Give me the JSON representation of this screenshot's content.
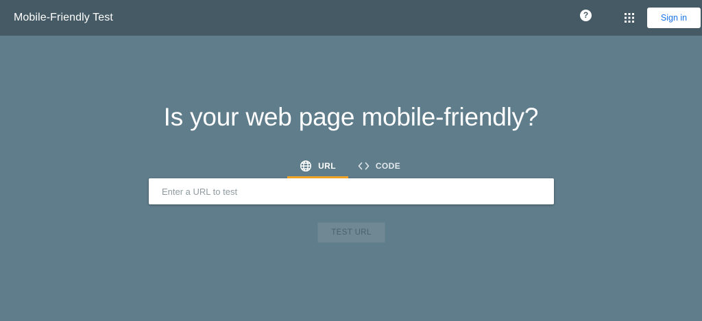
{
  "header": {
    "title": "Mobile-Friendly Test",
    "help_label": "?",
    "apps_icon": "apps-grid-icon",
    "sign_in_label": "Sign in"
  },
  "main": {
    "headline": "Is your web page mobile-friendly?",
    "tabs": [
      {
        "label": "URL",
        "icon": "globe-icon",
        "selected": true
      },
      {
        "label": "CODE",
        "icon": "code-brackets-icon",
        "selected": false
      }
    ],
    "url_input": {
      "value": "",
      "placeholder": "Enter a URL to test"
    },
    "test_button_label": "TEST URL"
  },
  "colors": {
    "header_bg": "#455a64",
    "page_bg": "#607d8b",
    "tab_indicator": "#f9a825",
    "sign_in_text": "#1a73e8"
  }
}
